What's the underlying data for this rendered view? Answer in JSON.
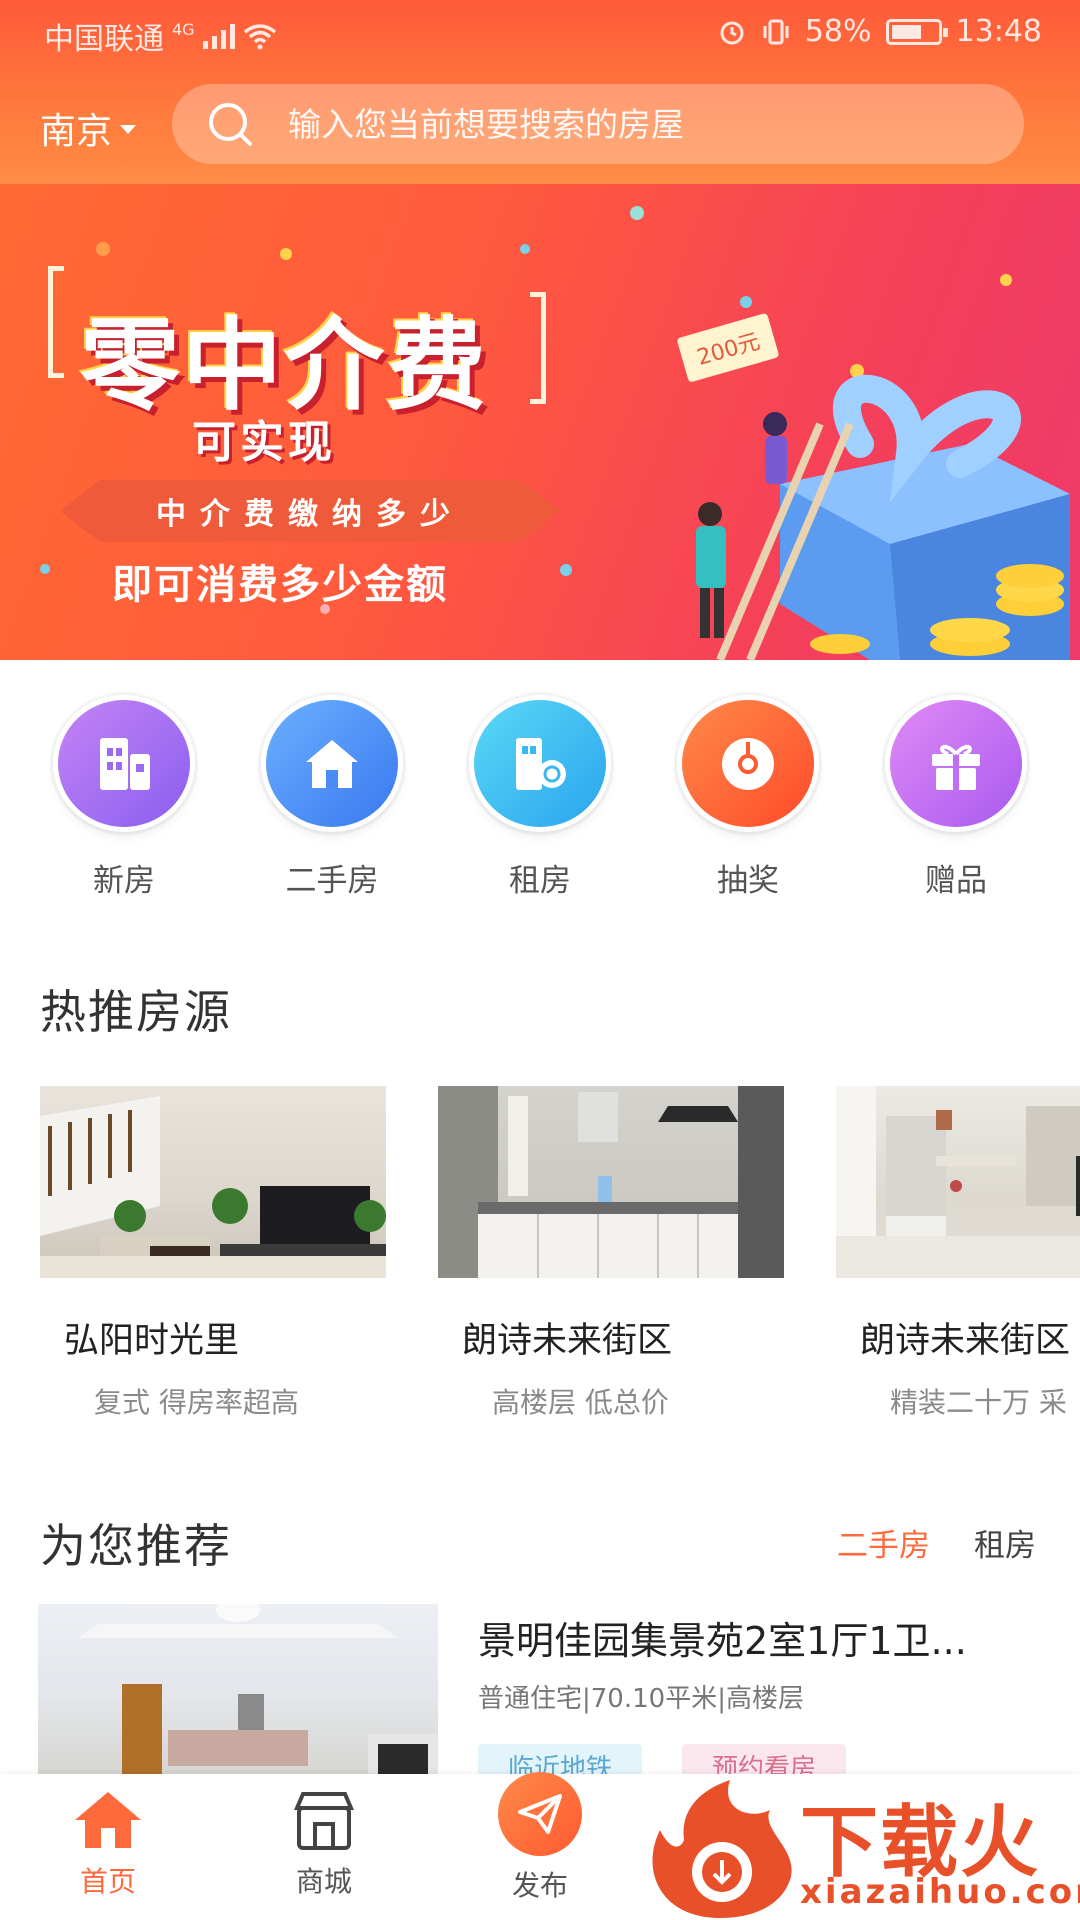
{
  "status_bar": {
    "carrier": "中国联通",
    "network": "4G",
    "battery": "58%",
    "time": "13:48"
  },
  "header": {
    "city": "南京",
    "search_placeholder": "输入您当前想要搜索的房屋"
  },
  "banner": {
    "title": "零中介费",
    "subtitle": "可实现",
    "ribbon": "中介费缴纳多少",
    "tagline": "即可消费多少金额",
    "coupon": "200元"
  },
  "categories": [
    {
      "label": "新房",
      "icon": "building-icon",
      "color": "#a86af0"
    },
    {
      "label": "二手房",
      "icon": "house-icon",
      "color": "#4a8cf5"
    },
    {
      "label": "租房",
      "icon": "key-building-icon",
      "color": "#3ab8f0"
    },
    {
      "label": "抽奖",
      "icon": "wheel-icon",
      "color": "#ff6030"
    },
    {
      "label": "赠品",
      "icon": "gift-icon",
      "color": "#c36cf5"
    }
  ],
  "hot": {
    "title": "热推房源",
    "items": [
      {
        "name": "弘阳时光里",
        "tags": "复式 得房率超高"
      },
      {
        "name": "朗诗未来街区",
        "tags": "高楼层 低总价"
      },
      {
        "name": "朗诗未来街区",
        "tags": "精装二十万 采"
      }
    ]
  },
  "recommend": {
    "title": "为您推荐",
    "tabs": [
      "二手房",
      "租房"
    ],
    "item": {
      "title": "景明佳园集景苑2室1厅1卫...",
      "meta": "普通住宅|70.10平米|高楼层",
      "badges": [
        "临近地铁",
        "预约看房"
      ]
    }
  },
  "bottom_nav": [
    {
      "label": "首页",
      "icon": "home-icon"
    },
    {
      "label": "商城",
      "icon": "shop-icon"
    },
    {
      "label": "发布",
      "icon": "send-icon"
    }
  ],
  "watermark": {
    "text": "下载火",
    "url": "xiazaihuo.com"
  },
  "colors": {
    "accent": "#ff6a3d",
    "header_top": "#ff5a3a",
    "header_bottom": "#ff8c44"
  }
}
